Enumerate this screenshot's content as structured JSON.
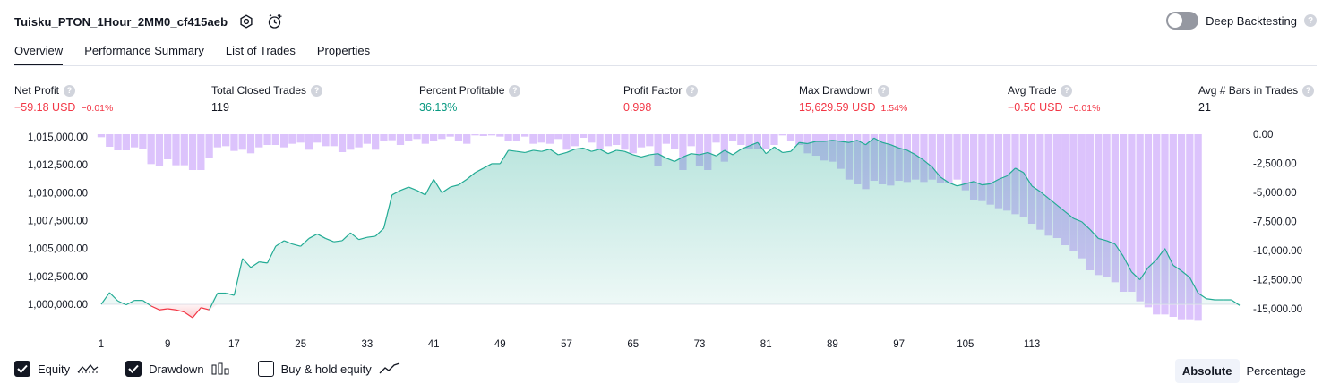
{
  "header": {
    "title": "Tuisku_PTON_1Hour_2MM0_cf415aeb",
    "deep_backtesting_label": "Deep Backtesting",
    "deep_backtesting_enabled": false,
    "help_glyph": "?"
  },
  "tabs": [
    {
      "label": "Overview",
      "active": true
    },
    {
      "label": "Performance Summary",
      "active": false
    },
    {
      "label": "List of Trades",
      "active": false
    },
    {
      "label": "Properties",
      "active": false
    }
  ],
  "metrics": {
    "net_profit": {
      "label": "Net Profit",
      "value": "−59.18 USD",
      "pct": "−0.01%"
    },
    "total_closed_trades": {
      "label": "Total Closed Trades",
      "value": "119"
    },
    "percent_profitable": {
      "label": "Percent Profitable",
      "value": "36.13%"
    },
    "profit_factor": {
      "label": "Profit Factor",
      "value": "0.998"
    },
    "max_drawdown": {
      "label": "Max Drawdown",
      "value": "15,629.59 USD",
      "pct": "1.54%"
    },
    "avg_trade": {
      "label": "Avg Trade",
      "value": "−0.50 USD",
      "pct": "−0.01%"
    },
    "avg_bars_in_trades": {
      "label": "Avg # Bars in Trades",
      "value": "21"
    }
  },
  "legend": {
    "equity": {
      "label": "Equity",
      "checked": true
    },
    "drawdown": {
      "label": "Drawdown",
      "checked": true
    },
    "buy_hold": {
      "label": "Buy & hold equity",
      "checked": false
    }
  },
  "mode": {
    "absolute": "Absolute",
    "percentage": "Percentage",
    "selected": "Absolute"
  },
  "colors": {
    "equity_line": "#22ab94",
    "equity_fill": "#c5ebe2",
    "loss_line": "#f23645",
    "drawdown_bar": "#d6b8fb",
    "axis_text": "#131722",
    "baseline": "#e0e3eb"
  },
  "chart_data": {
    "type": "area",
    "x_tick_labels": [
      "1",
      "9",
      "17",
      "25",
      "33",
      "41",
      "49",
      "57",
      "65",
      "73",
      "81",
      "89",
      "97",
      "105",
      "113"
    ],
    "y_left_ticks": [
      "1,015,000.00",
      "1,012,500.00",
      "1,010,000.00",
      "1,007,500.00",
      "1,005,000.00",
      "1,002,500.00",
      "1,000,000.00"
    ],
    "y_right_ticks": [
      "0.00",
      "-2,500.00",
      "-5,000.00",
      "-7,500.00",
      "-10,000.00",
      "-12,500.00",
      "-15,000.00"
    ],
    "equity_ylim": [
      1000000,
      1015000
    ],
    "drawdown_ylim": [
      -15000,
      0
    ],
    "initial_capital": 1000000,
    "series": [
      {
        "name": "Equity",
        "values": [
          1000000,
          1001050,
          1000300,
          999950,
          1000350,
          1000350,
          999850,
          999500,
          999600,
          999500,
          999300,
          998800,
          999700,
          999500,
          1001000,
          1001000,
          1000800,
          1004100,
          1003300,
          1003800,
          1003700,
          1005200,
          1005700,
          1005400,
          1005200,
          1005900,
          1006300,
          1005900,
          1005600,
          1005700,
          1006400,
          1005800,
          1006000,
          1006100,
          1006800,
          1009800,
          1010200,
          1010500,
          1010200,
          1009800,
          1011200,
          1010000,
          1010500,
          1010700,
          1011200,
          1011800,
          1012200,
          1012600,
          1012600,
          1013800,
          1013700,
          1013600,
          1013800,
          1013700,
          1013900,
          1013400,
          1013600,
          1013900,
          1014000,
          1013700,
          1013900,
          1013500,
          1013800,
          1013700,
          1013400,
          1013200,
          1013400,
          1013500,
          1013100,
          1012800,
          1013200,
          1013500,
          1013400,
          1013600,
          1013300,
          1013800,
          1013400,
          1013900,
          1014200,
          1014500,
          1013500,
          1014100,
          1013600,
          1013700,
          1014500,
          1014400,
          1014600,
          1014600,
          1014700,
          1014600,
          1014500,
          1014700,
          1014300,
          1014900,
          1014500,
          1014300,
          1014000,
          1013800,
          1013400,
          1012900,
          1012300,
          1011400,
          1010900,
          1010600,
          1010800,
          1011000,
          1010700,
          1010800,
          1011200,
          1011500,
          1012200,
          1011800,
          1010600,
          1010100,
          1009500,
          1008900,
          1008300,
          1007700,
          1007400,
          1006700,
          1005900,
          1005700,
          1005400,
          1004300,
          1002900,
          1002200,
          1003300,
          1004000,
          1005000,
          1003500,
          1003000,
          1002400,
          1001000,
          1000500,
          1000400,
          1000400,
          1000400,
          999900
        ]
      },
      {
        "name": "Drawdown",
        "values": [
          -250,
          -1050,
          -1350,
          -1350,
          -1100,
          -1200,
          -2500,
          -2700,
          -2100,
          -2600,
          -2600,
          -3000,
          -3000,
          -2000,
          -1100,
          -1000,
          -1400,
          -1300,
          -1600,
          -1100,
          -900,
          -900,
          -1100,
          -800,
          -700,
          -1300,
          -700,
          -1000,
          -1000,
          -1500,
          -1300,
          -1100,
          -800,
          -1300,
          -600,
          -500,
          -900,
          -600,
          -400,
          -800,
          -600,
          -400,
          -200,
          -600,
          -800,
          -100,
          -150,
          -100,
          -200,
          -600,
          -600,
          -200,
          -800,
          -700,
          -800,
          -400,
          -1300,
          -1000,
          -300,
          -700,
          -1200,
          -1000,
          -900,
          -1300,
          -1600,
          -1100,
          -1000,
          -2700,
          -800,
          -1200,
          -3000,
          -1000,
          -2700,
          -3000,
          -700,
          -2300,
          -600,
          -900,
          -1200,
          -1200,
          -1200,
          -900,
          -100,
          -600,
          -900,
          -1600,
          -1800,
          -2200,
          -2300,
          -2900,
          -3800,
          -4200,
          -4600,
          -3900,
          -4200,
          -4300,
          -3900,
          -4000,
          -3800,
          -4000,
          -3800,
          -4100,
          -4100,
          -3800,
          -4700,
          -5500,
          -5600,
          -5900,
          -6200,
          -6400,
          -6700,
          -6900,
          -7500,
          -8000,
          -8500,
          -8700,
          -9300,
          -9800,
          -10400,
          -11400,
          -11800,
          -12000,
          -12400,
          -13200,
          -13200,
          -14000,
          -14500,
          -15100,
          -15100,
          -15300,
          -15500,
          -15500,
          -15629
        ]
      }
    ]
  }
}
